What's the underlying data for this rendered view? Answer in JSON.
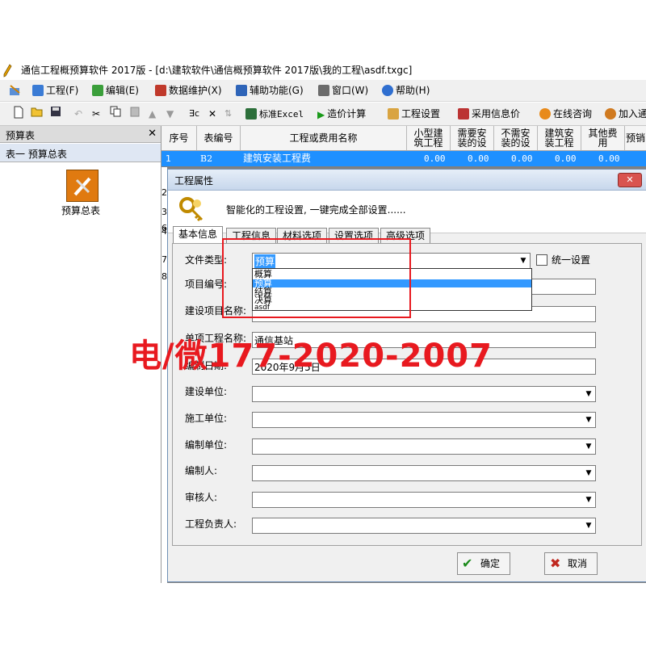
{
  "window": {
    "title": "通信工程概预算软件 2017版 - [d:\\建软软件\\通信概预算软件 2017版\\我的工程\\asdf.txgc]"
  },
  "menu": [
    "工程(F)",
    "编辑(E)",
    "数据维护(X)",
    "辅助功能(G)",
    "窗口(W)",
    "帮助(H)"
  ],
  "toolbar": {
    "standard_excel": "标准Excel",
    "calc": "造价计算",
    "project_settings": "工程设置",
    "use_info_price": "采用信息价",
    "online_consult": "在线咨询",
    "join": "加入通"
  },
  "left_panel": {
    "header": "预算表",
    "close": "✕",
    "tab": "表一  预算总表",
    "icon_label": "预算总表"
  },
  "grid": {
    "headers": [
      "序号",
      "表编号",
      "工程或费用名称",
      "小型建\n筑工程",
      "需要安\n装的设",
      "不需安\n装的设",
      "建筑安\n装工程",
      "其他费\n用",
      "预销"
    ],
    "row1": {
      "num": "1",
      "code": "B2",
      "name": "建筑安装工程费",
      "v1": "0.00",
      "v2": "0.00",
      "v3": "0.00",
      "v4": "0.00",
      "v5": "0.00"
    },
    "row_numbers": [
      "2",
      "3",
      "4",
      "5",
      "6",
      "7",
      "8"
    ]
  },
  "dialog": {
    "title": "工程属性",
    "close": "✕",
    "banner_text": "智能化的工程设置, 一键完成全部设置......",
    "tabs": [
      "基本信息",
      "工程信息",
      "材料选项",
      "设置选项",
      "高级选项"
    ],
    "file_type_label": "文件类型:",
    "file_type_value": "预算",
    "file_type_options": [
      "概算",
      "预算",
      "结算",
      "决算",
      "asdf"
    ],
    "unified_setting": "统一设置",
    "fields": [
      {
        "label": "项目编号:",
        "value": ""
      },
      {
        "label": "建设项目名称:",
        "value": ""
      },
      {
        "label": "单项工程名称:",
        "value": "通信基站"
      },
      {
        "label": "编制日期:",
        "value": "2020年9月5日"
      },
      {
        "label": "建设单位:",
        "value": ""
      },
      {
        "label": "施工单位:",
        "value": ""
      },
      {
        "label": "编制单位:",
        "value": ""
      },
      {
        "label": "编制人:",
        "value": ""
      },
      {
        "label": "审核人:",
        "value": ""
      },
      {
        "label": "工程负责人:",
        "value": ""
      }
    ],
    "ok": "确定",
    "cancel": "取消"
  },
  "watermark": "电/微177-2020-2007",
  "colors": {
    "selection": "#3399ff",
    "row_highlight": "#1e90ff",
    "annotation": "#e8191f"
  }
}
